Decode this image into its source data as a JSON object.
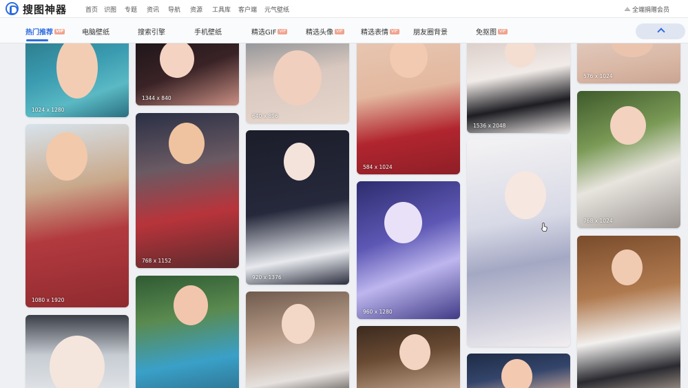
{
  "header": {
    "logo_text": "搜图神器",
    "nav": [
      "首页",
      "识图",
      "专题",
      "资讯",
      "导航",
      "资源",
      "工具库",
      "客户端",
      "元气壁纸"
    ],
    "vip_link": "全端捐赠会员"
  },
  "categories": [
    {
      "label": "热门推荐",
      "vip": true,
      "active": true
    },
    {
      "label": "电脑壁纸",
      "vip": false,
      "active": false
    },
    {
      "label": "搜索引擎",
      "vip": false,
      "active": false
    },
    {
      "label": "手机壁纸",
      "vip": false,
      "active": false
    },
    {
      "label": "精选GIF",
      "vip": true,
      "active": false
    },
    {
      "label": "精选头像",
      "vip": true,
      "active": false
    },
    {
      "label": "精选表情",
      "vip": true,
      "active": false
    },
    {
      "label": "朋友圈背景",
      "vip": false,
      "active": false
    },
    {
      "label": "免抠图",
      "vip": true,
      "active": false
    }
  ],
  "vip_badge": "VIP",
  "icons": {
    "logo": "logo-icon",
    "vip": "crown-icon",
    "collapse": "chevron-up-icon",
    "cursor": "hand-pointer-icon"
  },
  "gallery": [
    {
      "dims": "1024 x 1280",
      "bg": "linear-gradient(160deg,#2c7a8a 0%,#3a9bb0 40%,#5ab9c4 70%,#2a6f80 100%)",
      "fig": "#f2cdb4"
    },
    {
      "dims": "1080 x 1920",
      "bg": "linear-gradient(170deg,#d7e3ec 0%,#c9a88a 35%,#b23a3f 60%,#8f2a2f 100%)",
      "fig": "#f3c9ab"
    },
    {
      "dims": "",
      "bg": "linear-gradient(180deg,#3a3f47 0%,#c7ccd3 45%,#e9ecef 100%)",
      "fig": "#f5e6dd"
    },
    {
      "dims": "1344 x 840",
      "bg": "linear-gradient(160deg,#1b1418 0%,#3a2326 50%,#c98f83 100%)",
      "fig": "#f4d3c2"
    },
    {
      "dims": "768 x 1152",
      "bg": "linear-gradient(170deg,#2a2f45 0%,#6a5a63 35%,#b8343b 65%,#5b2a2c 100%)",
      "fig": "#efc39f"
    },
    {
      "dims": "",
      "bg": "linear-gradient(170deg,#2f5a33 0%,#5a8a4f 35%,#3aa0c8 70%,#2c6f8c 100%)",
      "fig": "#f2c6ad"
    },
    {
      "dims": "640 x 896",
      "bg": "linear-gradient(170deg,#8a8f94 0%,#d9c8bf 45%,#e7d6cc 100%)",
      "fig": "#f0cfbe"
    },
    {
      "dims": "920 x 1376",
      "bg": "linear-gradient(170deg,#1b1d2a 0%,#26293b 50%,#e7e9ee 80%,#2a2d3c 100%)",
      "fig": "#f4e3da"
    },
    {
      "dims": "",
      "bg": "linear-gradient(170deg,#6f5a4c 0%,#b79c89 40%,#e6e1de 75%,#3b3431 100%)",
      "fig": "#f3d8c7"
    },
    {
      "dims": "584 x 1024",
      "bg": "linear-gradient(170deg,#e7c7b3 0%,#e3b89f 40%,#b1252f 70%,#8e1f27 100%)",
      "fig": "#f2cab2"
    },
    {
      "dims": "960 x 1280",
      "bg": "linear-gradient(160deg,#2d2c6e 0%,#5e58b5 40%,#bdb6ee 65%,#3f3a86 100%)",
      "fig": "#e9e1f7"
    },
    {
      "dims": "",
      "bg": "linear-gradient(170deg,#3b2a1f 0%,#6a4b33 40%,#d7b9a3 100%)",
      "fig": "#f3d4c3"
    },
    {
      "dims": "1536 x 2048",
      "bg": "linear-gradient(170deg,#d9cbc5 0%,#f1ebe8 40%,#1d1d22 70%,#eae5e4 100%)",
      "fig": "#f4ddd1"
    },
    {
      "dims": "",
      "bg": "linear-gradient(170deg,#f4f2f3 0%,#d7d9e6 40%,#a4a8c3 60%,#f2eef0 100%)",
      "fig": "#f6e7e0"
    },
    {
      "dims": "",
      "bg": "linear-gradient(170deg,#1d2b45 0%,#34456b 45%,#f0c4a7 100%)",
      "fig": "#f3c9b0"
    },
    {
      "dims": "576 x 1024",
      "bg": "linear-gradient(170deg,#e2cbbf 0%,#d9b7a5 60%,#caa493 100%)",
      "fig": "#ebc4ae"
    },
    {
      "dims": "768 x 1024",
      "bg": "linear-gradient(160deg,#3e5a2b 0%,#7a9a56 35%,#e8e4de 60%,#9a9591 100%)",
      "fig": "#f3d2bf"
    },
    {
      "dims": "",
      "bg": "linear-gradient(170deg,#7a4c2c 0%,#b07a4f 35%,#f2f0ee 60%,#2a2a30 80%,#c9b9a8 100%)",
      "fig": "#f0cbb2"
    }
  ]
}
